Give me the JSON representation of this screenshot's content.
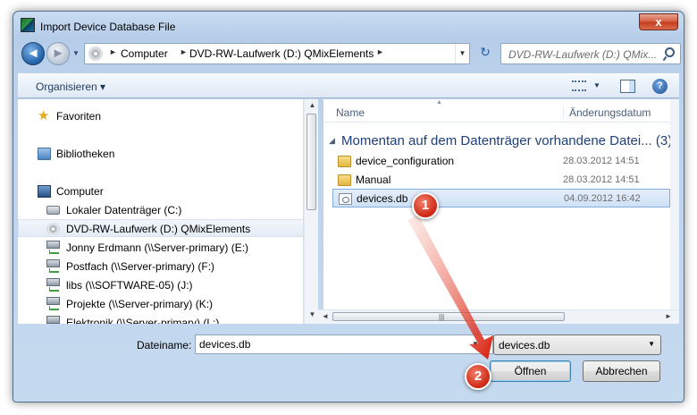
{
  "window": {
    "title": "Import Device Database File",
    "close_label": "x"
  },
  "address": {
    "crumbs": [
      "Computer",
      "DVD-RW-Laufwerk (D:) QMixElements"
    ],
    "search_placeholder": "DVD-RW-Laufwerk (D:) QMix..."
  },
  "toolbar": {
    "organize_label": "Organisieren ▾",
    "help_label": "?"
  },
  "nav_pane": {
    "items": [
      {
        "label": "Favoriten",
        "icon": "star-icon"
      },
      {
        "label": "Bibliotheken",
        "icon": "library-icon"
      },
      {
        "label": "Computer",
        "icon": "computer-icon"
      },
      {
        "label": "Lokaler Datenträger (C:)",
        "icon": "hard-drive-icon"
      },
      {
        "label": "DVD-RW-Laufwerk (D:) QMixElements",
        "icon": "dvd-drive-icon"
      },
      {
        "label": "Jonny Erdmann (\\\\Server-primary) (E:)",
        "icon": "network-drive-icon"
      },
      {
        "label": "Postfach (\\\\Server-primary) (F:)",
        "icon": "network-drive-icon"
      },
      {
        "label": "libs (\\\\SOFTWARE-05) (J:)",
        "icon": "network-drive-icon"
      },
      {
        "label": "Projekte (\\\\Server-primary) (K:)",
        "icon": "network-drive-icon"
      },
      {
        "label": "Elektronik (\\\\Server-primary) (L:)",
        "icon": "network-drive-icon"
      }
    ]
  },
  "file_list": {
    "columns": [
      "Name",
      "Änderungsdatum"
    ],
    "group_header": "Momentan auf dem Datenträger vorhandene Datei... (3)",
    "rows": [
      {
        "name": "device_configuration",
        "date": "28.03.2012 14:51",
        "type": "folder"
      },
      {
        "name": "Manual",
        "date": "28.03.2012 14:51",
        "type": "folder"
      },
      {
        "name": "devices.db",
        "date": "04.09.2012 16:42",
        "type": "db-file"
      }
    ]
  },
  "bottom": {
    "filename_label": "Dateiname:",
    "filename_value": "devices.db",
    "filter_value": "devices.db",
    "open_label": "Öffnen",
    "cancel_label": "Abbrechen"
  },
  "annotations": {
    "badge_1": "1",
    "badge_2": "2",
    "color": "#d12c1a"
  }
}
